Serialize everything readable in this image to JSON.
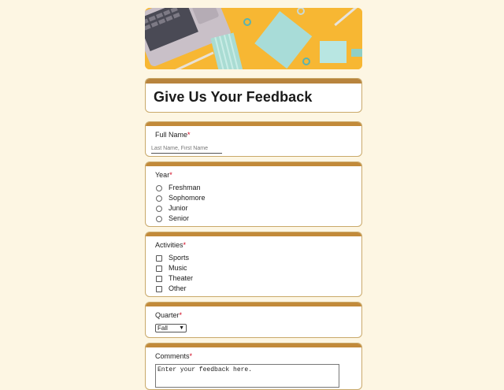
{
  "form": {
    "title": "Give Us Your Feedback",
    "required_mark": "*",
    "full_name": {
      "label": "Full Name",
      "placeholder": "Last Name, First Name"
    },
    "year": {
      "label": "Year",
      "options": [
        "Freshman",
        "Sophomore",
        "Junior",
        "Senior"
      ]
    },
    "activities": {
      "label": "Activities",
      "options": [
        "Sports",
        "Music",
        "Theater",
        "Other"
      ]
    },
    "quarter": {
      "label": "Quarter",
      "selected": "Fall"
    },
    "comments": {
      "label": "Comments",
      "value": "Enter your feedback here."
    }
  },
  "colors": {
    "page_bg": "#fdf6e3",
    "accent_bar": "#c28a3a",
    "banner_bg": "#f6b93b",
    "required": "#d0021b"
  }
}
